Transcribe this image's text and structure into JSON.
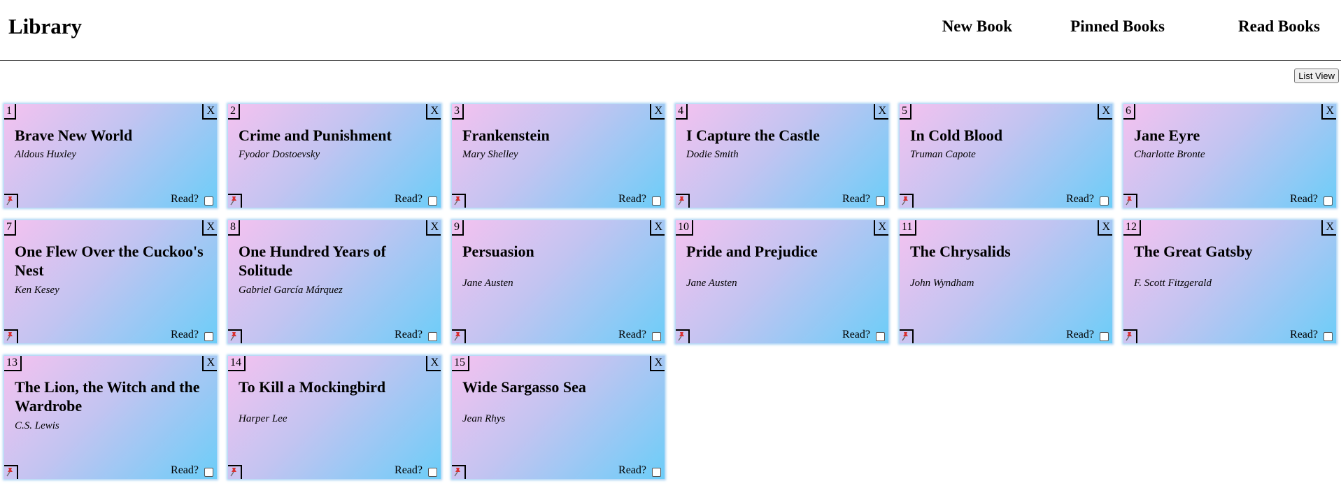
{
  "header": {
    "title": "Library",
    "nav": [
      "New Book",
      "Pinned Books",
      "Read Books"
    ]
  },
  "toolbar": {
    "view_toggle_label": "List View"
  },
  "card_labels": {
    "close": "X",
    "read": "Read?"
  },
  "books": [
    {
      "number": "1",
      "title": "Brave New World",
      "author": "Aldous Huxley",
      "read": false
    },
    {
      "number": "2",
      "title": "Crime and Punishment",
      "author": "Fyodor Dostoevsky",
      "read": false
    },
    {
      "number": "3",
      "title": "Frankenstein",
      "author": "Mary Shelley",
      "read": false
    },
    {
      "number": "4",
      "title": "I Capture the Castle",
      "author": "Dodie Smith",
      "read": false
    },
    {
      "number": "5",
      "title": "In Cold Blood",
      "author": "Truman Capote",
      "read": false
    },
    {
      "number": "6",
      "title": "Jane Eyre",
      "author": "Charlotte Bronte",
      "read": false
    },
    {
      "number": "7",
      "title": "One Flew Over the Cuckoo's Nest",
      "author": "Ken Kesey",
      "read": false
    },
    {
      "number": "8",
      "title": "One Hundred Years of Solitude",
      "author": "Gabriel García Márquez",
      "read": false
    },
    {
      "number": "9",
      "title": "Persuasion",
      "author": "Jane Austen",
      "read": false
    },
    {
      "number": "10",
      "title": "Pride and Prejudice",
      "author": "Jane Austen",
      "read": false
    },
    {
      "number": "11",
      "title": "The Chrysalids",
      "author": "John Wyndham",
      "read": false
    },
    {
      "number": "12",
      "title": "The Great Gatsby",
      "author": "F. Scott Fitzgerald",
      "read": false
    },
    {
      "number": "13",
      "title": "The Lion, the Witch and the Wardrobe",
      "author": "C.S. Lewis",
      "read": false
    },
    {
      "number": "14",
      "title": "To Kill a Mockingbird",
      "author": "Harper Lee",
      "read": false
    },
    {
      "number": "15",
      "title": "Wide Sargasso Sea",
      "author": "Jean Rhys",
      "read": false
    }
  ]
}
